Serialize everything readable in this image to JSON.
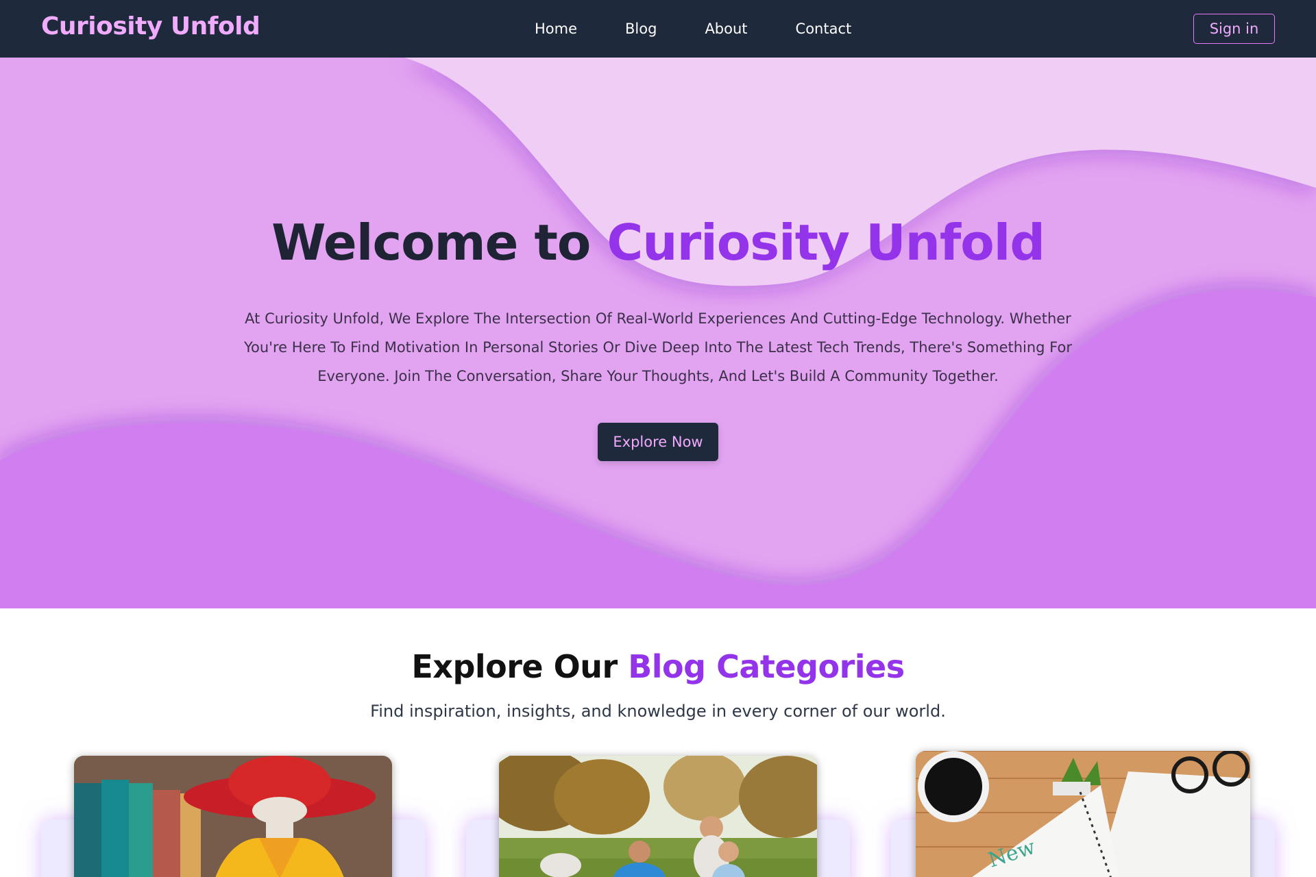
{
  "nav": {
    "brand": "Curiosity Unfold",
    "links": [
      "Home",
      "Blog",
      "About",
      "Contact"
    ],
    "signin": "Sign in"
  },
  "hero": {
    "title_main": "Welcome to ",
    "title_accent": "Curiosity Unfold",
    "description": "At Curiosity Unfold, We Explore The Intersection Of Real-World Experiences And Cutting-Edge Technology. Whether You're Here To Find Motivation In Personal Stories Or Dive Deep Into The Latest Tech Trends, There's Something For Everyone. Join The Conversation, Share Your Thoughts, And Let's Build A Community Together.",
    "cta": "Explore Now"
  },
  "categories": {
    "title_main": "Explore Our ",
    "title_accent": "Blog Categories",
    "subtitle": "Find inspiration, insights, and knowledge in every corner of our world."
  },
  "colors": {
    "nav_bg": "#1e293b",
    "brand": "#f0abfc",
    "accent": "#9333ea",
    "hero_light": "#f0cdf5",
    "hero_mid": "#e2a4f1",
    "hero_dark": "#d17ff0"
  }
}
